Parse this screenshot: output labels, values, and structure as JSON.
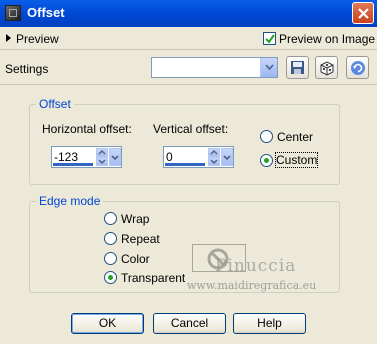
{
  "window": {
    "title": "Offset",
    "close_icon": "close-icon"
  },
  "preview": {
    "label": "Preview",
    "checkbox_label": "Preview on Image",
    "checked": true
  },
  "settings": {
    "label": "Settings",
    "value": ""
  },
  "offset_group": {
    "title": "Offset",
    "horizontal_label": "Horizontal offset:",
    "horizontal_value": "-123",
    "vertical_label": "Vertical offset:",
    "vertical_value": "0",
    "center_label": "Center",
    "custom_label": "Custom",
    "selected": "Custom"
  },
  "edge_group": {
    "title": "Edge mode",
    "options": [
      "Wrap",
      "Repeat",
      "Color",
      "Transparent"
    ],
    "selected": "Transparent"
  },
  "watermark": {
    "name": "Pinuccia",
    "url": "www.maidiregrafica.eu"
  },
  "buttons": {
    "ok": "OK",
    "cancel": "Cancel",
    "help": "Help"
  },
  "colors": {
    "titlebar": "#0049d4",
    "group_title": "#0046d5",
    "radio_selected": "#21a121"
  }
}
